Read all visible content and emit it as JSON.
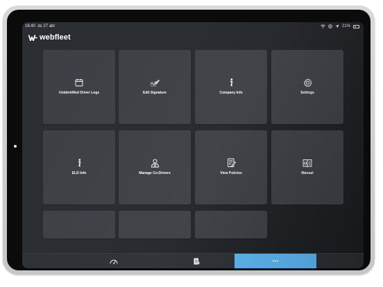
{
  "status_bar": {
    "time": "16:40",
    "date": "dc 27 abr",
    "battery": "21%"
  },
  "app": {
    "logo_text": "webfleet"
  },
  "tiles": [
    {
      "label": "Unidentified Driver Logs",
      "icon": "calendar-icon"
    },
    {
      "label": "Edit Signature",
      "icon": "signature-icon"
    },
    {
      "label": "Company Info",
      "icon": "info-icon"
    },
    {
      "label": "Settings",
      "icon": "gear-icon"
    },
    {
      "label": "ELD Info",
      "icon": "info-icon"
    },
    {
      "label": "Manage Co-Drivers",
      "icon": "driver-icon"
    },
    {
      "label": "View Policies",
      "icon": "document-edit-icon"
    },
    {
      "label": "Manual",
      "icon": "book-gear-icon"
    }
  ],
  "tab_bar": {
    "tabs": [
      {
        "icon": "speedometer-icon",
        "active": false
      },
      {
        "icon": "logbook-icon",
        "active": false
      },
      {
        "icon": "more-icon",
        "label": "•••",
        "active": true
      }
    ]
  },
  "colors": {
    "tile": "#3b3f44",
    "active_tab": "#5bb8f5",
    "background": "#25292d"
  }
}
